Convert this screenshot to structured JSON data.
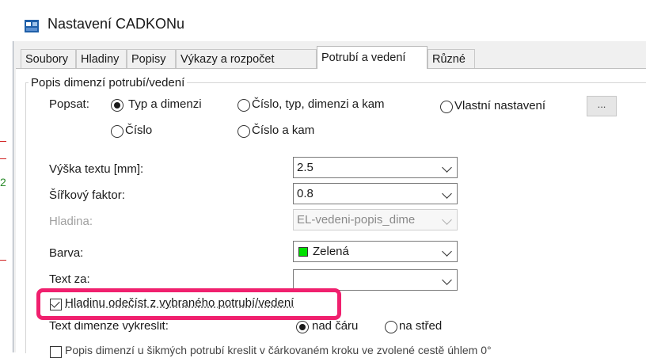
{
  "window": {
    "title": "Nastavení CADKONu"
  },
  "background": {
    "side_text": "2"
  },
  "tabs": [
    {
      "label": "Soubory"
    },
    {
      "label": "Hladiny"
    },
    {
      "label": "Popisy"
    },
    {
      "label": "Výkazy a rozpočet"
    },
    {
      "label": "Potrubí a vedení"
    },
    {
      "label": "Různé"
    }
  ],
  "group": {
    "title": "Popis dimenzí potrubí/vedení",
    "describe_label": "Popsat:",
    "radios": {
      "type_dim": "Typ a dimenzi",
      "num_type_dim_where": "Číslo, typ, dimenzi a kam",
      "custom": "Vlastní nastavení",
      "num": "Číslo",
      "num_where": "Číslo a kam"
    },
    "dots_button": "...",
    "text_height_label": "Výška textu [mm]:",
    "text_height_value": "2.5",
    "width_factor_label": "Šířkový faktor:",
    "width_factor_value": "0.8",
    "layer_label": "Hladina:",
    "layer_value": "EL-vedeni-popis_dime",
    "color_label": "Barva:",
    "color_value": "Zelená",
    "color_swatch": "#00e000",
    "text_after_label": "Text za:",
    "text_after_value": "",
    "layer_from_checkbox": "Hladinu odečíst z vybraného potrubí/vedení",
    "draw_dim_label": "Text dimenze vykreslit:",
    "above_line": "nad čáru",
    "on_center": "na střed",
    "bottom_checkbox": "Popis dimenzí u šikmých potrubí kreslit v čárkovaném kroku ve zvolené cestě úhlem 0°"
  },
  "colors": {
    "highlight": "#f0206e",
    "title_icon": "#1f5fa8"
  }
}
